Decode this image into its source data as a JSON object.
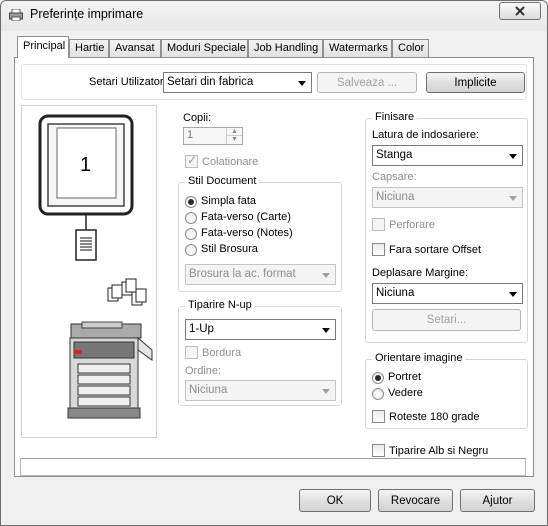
{
  "window": {
    "title": "Preferințe imprimare"
  },
  "tabs": [
    {
      "label": "Principal"
    },
    {
      "label": "Hartie"
    },
    {
      "label": "Avansat"
    },
    {
      "label": "Moduri Speciale"
    },
    {
      "label": "Job Handling"
    },
    {
      "label": "Watermarks"
    },
    {
      "label": "Color"
    }
  ],
  "user_settings": {
    "label": "Setari Utilizator:",
    "value": "Setari din fabrica",
    "save_label": "Salveaza ...",
    "defaults_label": "Implicite"
  },
  "preview": {
    "copies_shown": "1"
  },
  "copies": {
    "label": "Copii:",
    "value": "1"
  },
  "collate": {
    "label": "Colationare"
  },
  "document_style": {
    "legend": "Stil Document",
    "options": [
      "Simpla fata",
      "Fata-verso (Carte)",
      "Fata-verso (Notes)",
      "Stil Brosura"
    ],
    "selected_index": 0,
    "booklet_value": "Brosura la ac. format"
  },
  "nup": {
    "legend": "Tiparire N-up",
    "value": "1-Up",
    "border_label": "Bordura",
    "order_label": "Ordine:",
    "order_value": "Niciuna"
  },
  "finishing": {
    "legend": "Finisare",
    "binding_label": "Latura de indosariere:",
    "binding_value": "Stanga",
    "staple_label": "Capsare:",
    "staple_value": "Niciuna",
    "punch_label": "Perforare",
    "offset_label": "Fara sortare Offset",
    "margin_label": "Deplasare Margine:",
    "margin_value": "Niciuna",
    "settings_label": "Setari..."
  },
  "orientation": {
    "legend": "Orientare imagine",
    "options": [
      "Portret",
      "Vedere"
    ],
    "selected_index": 0,
    "rotate_label": "Roteste 180 grade"
  },
  "bw": {
    "label": "Tiparire Alb si Negru"
  },
  "buttons": {
    "ok": "OK",
    "cancel": "Revocare",
    "help": "Ajutor"
  }
}
